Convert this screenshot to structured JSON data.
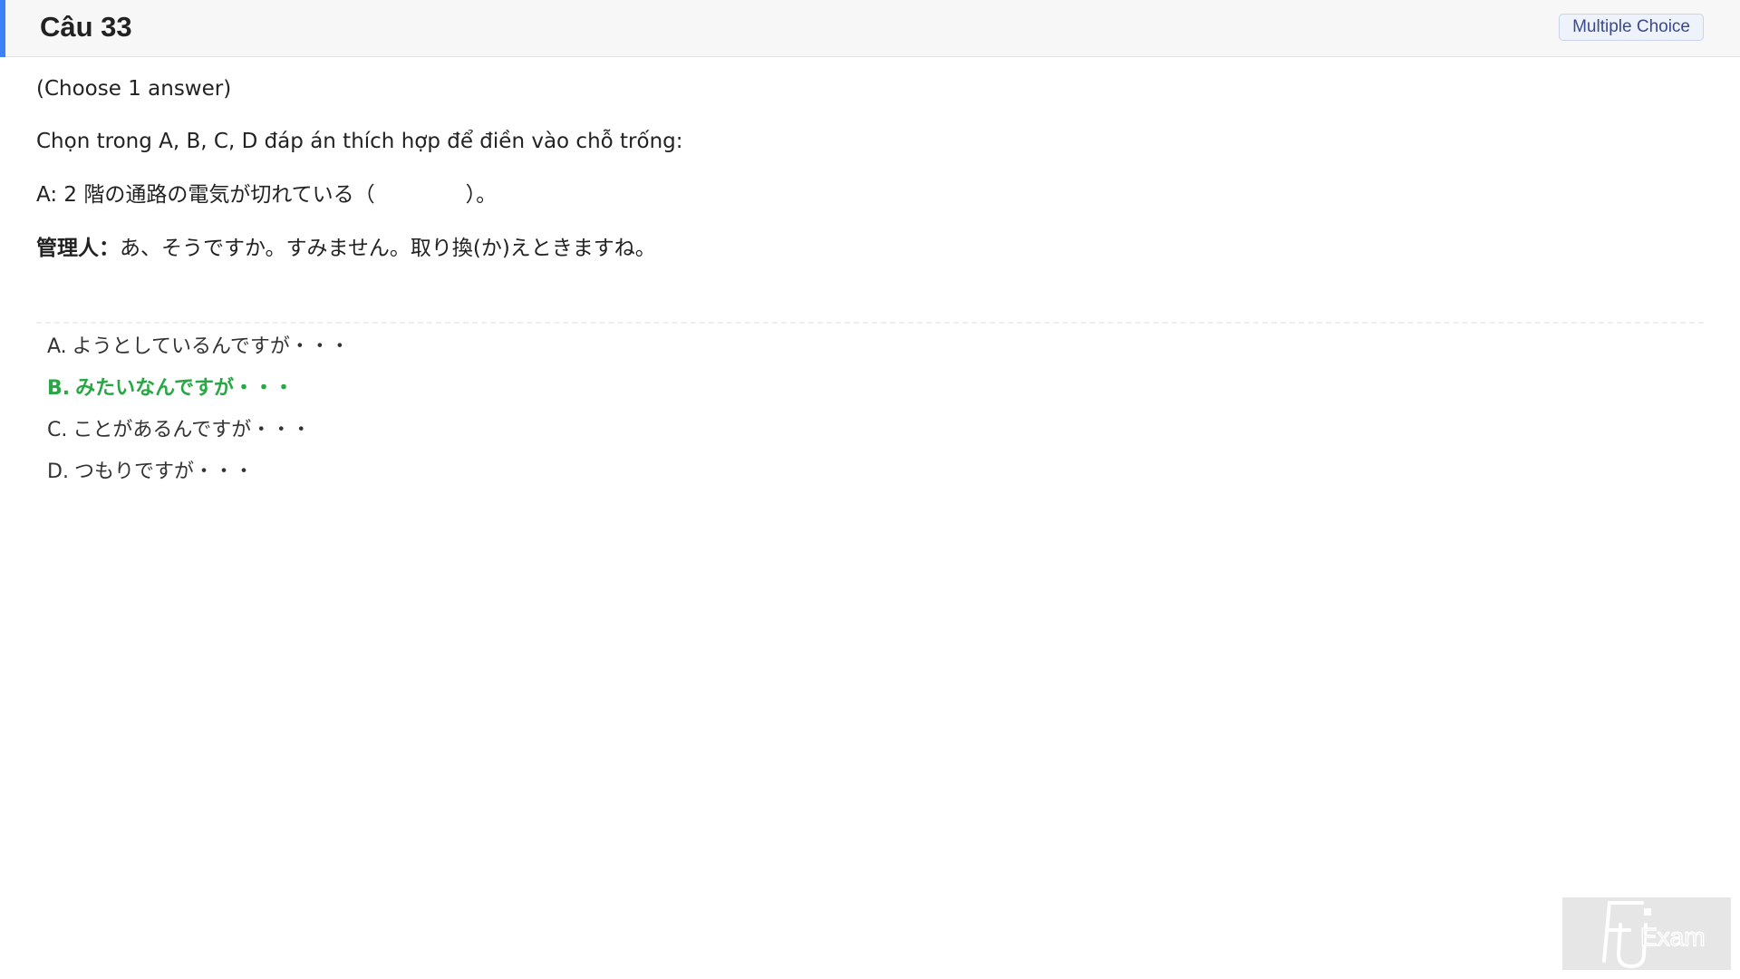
{
  "header": {
    "question_title": "Câu 33",
    "question_type": "Multiple Choice",
    "accent_color": "#3b82f6"
  },
  "question": {
    "instruction": "(Choose 1 answer)",
    "directive": "Chọn trong A, B, C, D đáp án thích hợp để điền vào chỗ trống:",
    "line_a_prefix": "A: 2 階の通路の電気が切れている（",
    "line_a_suffix": "）。",
    "line_b_speaker": "管理人：",
    "line_b_text": "あ、そうですか。すみません。取り換(か)えときますね。"
  },
  "options": [
    {
      "letter": "A.",
      "text": "ようとしているんですが・・・",
      "correct": false
    },
    {
      "letter": "B.",
      "text": "みたいなんですが・・・",
      "correct": true
    },
    {
      "letter": "C.",
      "text": "ことがあるんですが・・・",
      "correct": false
    },
    {
      "letter": "D.",
      "text": "つもりですが・・・",
      "correct": false
    }
  ],
  "colors": {
    "correct_answer": "#28a745",
    "badge_text": "#3b4a8c",
    "header_bg": "#f7f7f7"
  },
  "watermark": {
    "logo_text": "FU Exam",
    "icon": "fu-exam-logo-icon"
  }
}
